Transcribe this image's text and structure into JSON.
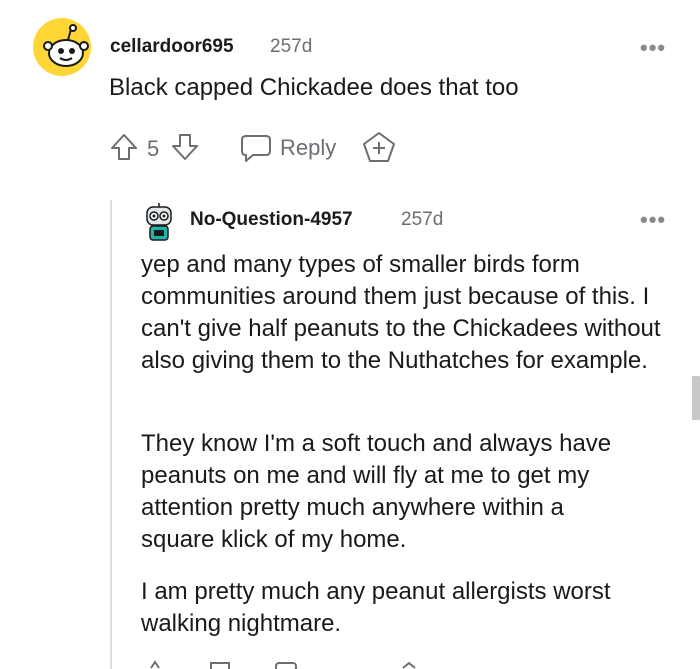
{
  "comment": {
    "username": "cellardoor695",
    "age": "257d",
    "text": "Black capped Chickadee does that too",
    "votes": "5",
    "reply_label": "Reply",
    "more_label": "•••"
  },
  "reply": {
    "username": "No-Question-4957",
    "age": "257d",
    "more_label": "•••",
    "paragraphs": [
      "yep and many types of smaller birds form communities around them just because of this. I can't give half peanuts to the Chickadees without also giving them to the Nuthatches for example.",
      "They know I'm a soft touch and always have peanuts on me and will fly at me to get my attention pretty much anywhere within a square klick of my home.",
      "I am pretty much any peanut allergists worst walking nightmare."
    ]
  },
  "icons": {
    "upvote": "arrow-up-icon",
    "downvote": "arrow-down-icon",
    "reply": "speech-bubble-icon",
    "award": "award-plus-icon"
  },
  "colors": {
    "text": "#1a1a1b",
    "meta": "#6b6f73",
    "avatar_bg": "#ffd635",
    "thread_line": "#dcdcdc"
  }
}
